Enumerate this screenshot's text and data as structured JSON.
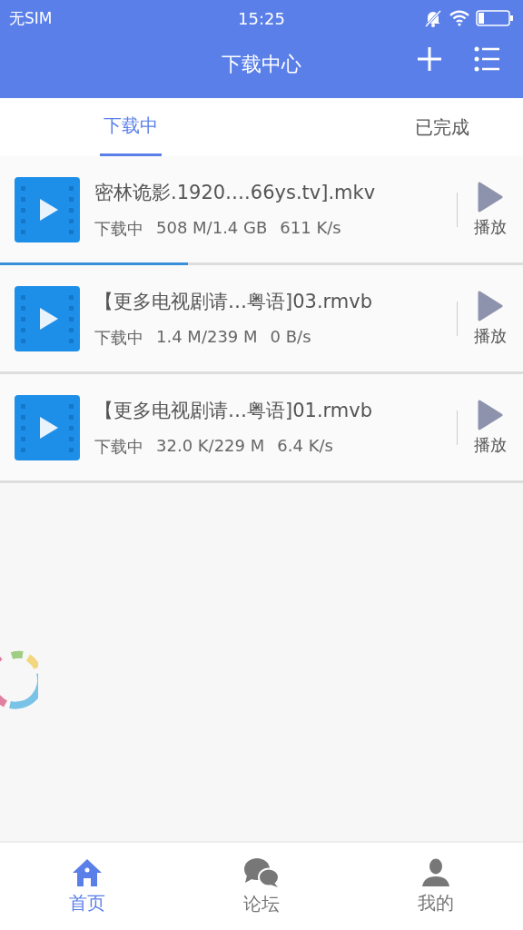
{
  "status_bar": {
    "carrier": "无SIM",
    "time": "15:25"
  },
  "header": {
    "title": "下载中心"
  },
  "tabs": [
    {
      "label": "下载中",
      "selected": true
    },
    {
      "label": "已完成",
      "selected": false
    }
  ],
  "downloads": [
    {
      "name": "密林诡影.1920….66ys.tv].mkv",
      "status": "下载中",
      "size": "508 M/1.4 GB",
      "speed": "611 K/s",
      "action": "播放",
      "level": 0.36
    },
    {
      "name": "【更多电视剧请…粤语]03.rmvb",
      "status": "下载中",
      "size": "1.4 M/239 M",
      "speed": "0 B/s",
      "action": "播放"
    },
    {
      "name": "【更多电视剧请…粤语]01.rmvb",
      "status": "下载中",
      "size": "32.0 K/229 M",
      "speed": "6.4 K/s",
      "action": "播放"
    }
  ],
  "bottom_nav": [
    {
      "label": "首页",
      "selected": true
    },
    {
      "label": "论坛",
      "selected": false
    },
    {
      "label": "我的",
      "selected": false
    }
  ]
}
